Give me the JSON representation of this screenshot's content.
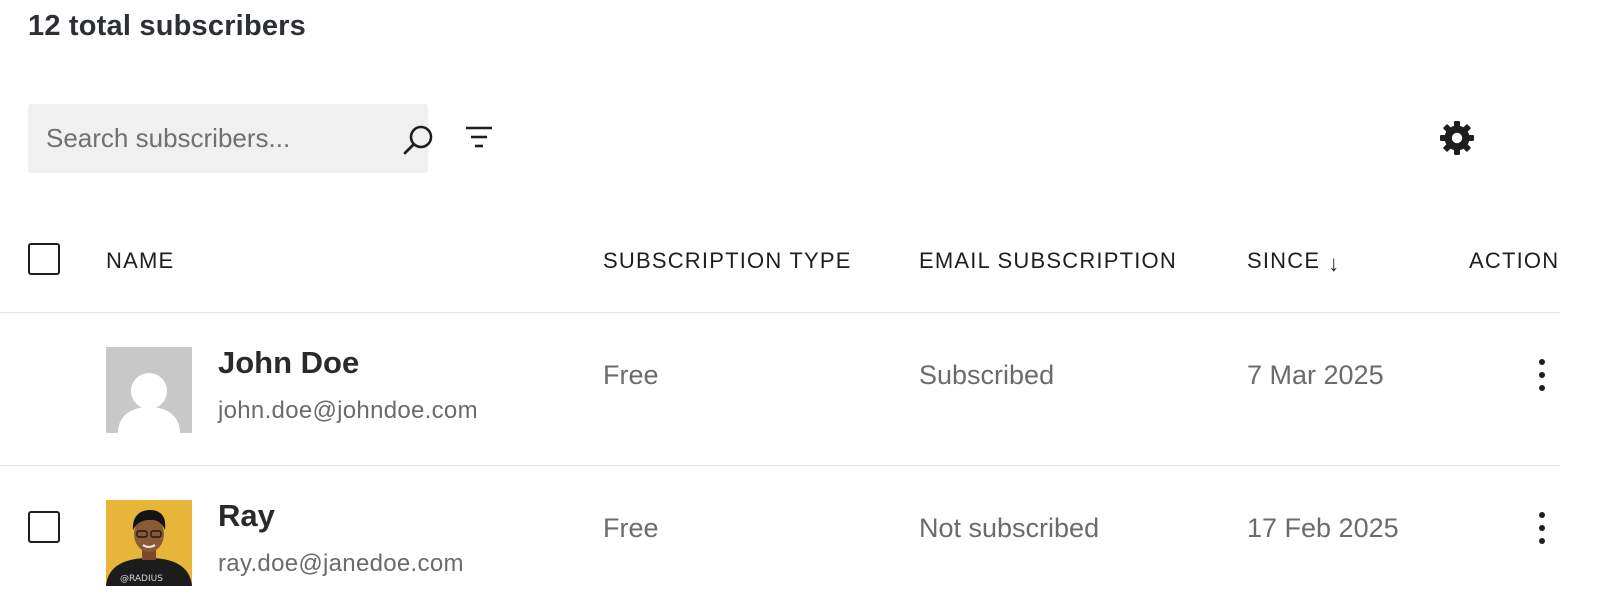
{
  "header": {
    "total_title": "12 total subscribers"
  },
  "toolbar": {
    "search_placeholder": "Search subscribers...",
    "search_icon": "search-icon",
    "filter_icon": "filter-icon",
    "settings_icon": "gear-icon"
  },
  "table": {
    "columns": {
      "name": "NAME",
      "subscription_type": "SUBSCRIPTION TYPE",
      "email_subscription": "EMAIL SUBSCRIPTION",
      "since": "SINCE",
      "since_sort": "↓",
      "actions": "ACTIONS"
    },
    "rows": [
      {
        "name": "John Doe",
        "email": "john.doe@johndoe.com",
        "subscription_type": "Free",
        "email_subscription": "Subscribed",
        "since": "7 Mar 2025",
        "avatar": "default-avatar",
        "checkbox_visible": false
      },
      {
        "name": "Ray",
        "email": "ray.doe@janedoe.com",
        "subscription_type": "Free",
        "email_subscription": "Not subscribed",
        "since": "17 Feb 2025",
        "avatar": "photo-avatar",
        "avatar_shirt_text": "@RADIUS",
        "checkbox_visible": true
      }
    ]
  },
  "colors": {
    "search_bg": "#f0f0f0",
    "divider": "#e4e4e4",
    "muted_text": "#6b6b6b",
    "avatar_placeholder": "#c8c8c8",
    "photo_bg": "#e8b53b"
  }
}
